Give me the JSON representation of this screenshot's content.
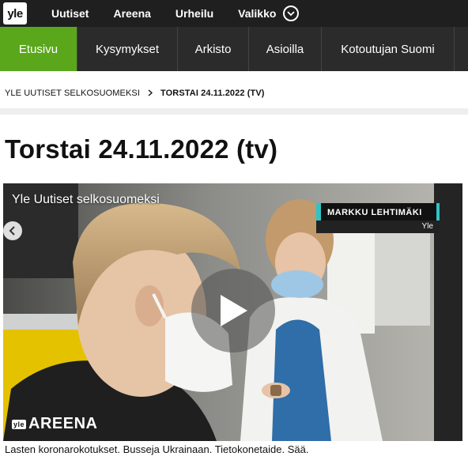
{
  "header": {
    "logo_text": "yle",
    "nav": [
      "Uutiset",
      "Areena",
      "Urheilu"
    ],
    "menu_label": "Valikko"
  },
  "subnav": {
    "tabs": [
      {
        "label": "Etusivu",
        "active": true
      },
      {
        "label": "Kysymykset",
        "active": false
      },
      {
        "label": "Arkisto",
        "active": false
      },
      {
        "label": "Asioilla",
        "active": false
      },
      {
        "label": "Kotoutujan Suomi",
        "active": false
      }
    ]
  },
  "breadcrumb": {
    "root": "YLE UUTISET SELKOSUOMEKSI",
    "current": "TORSTAI 24.11.2022 (TV)"
  },
  "page_title": "Torstai 24.11.2022 (tv)",
  "video": {
    "title": "Yle Uutiset selkosuomeksi",
    "name_plate": "MARKKU LEHTIMÄKI",
    "name_org": "Yle",
    "areena_logo": "yle",
    "areena_label": "AREENA"
  },
  "caption": "Lasten koronarokotukset. Busseja Ukrainaan. Tietokonetaide. Sää.",
  "colors": {
    "topbar": "#1f1f1f",
    "subnav": "#2b2b2b",
    "active_tab": "#5aa71c",
    "name_plate_accent": "#30c3c7"
  }
}
